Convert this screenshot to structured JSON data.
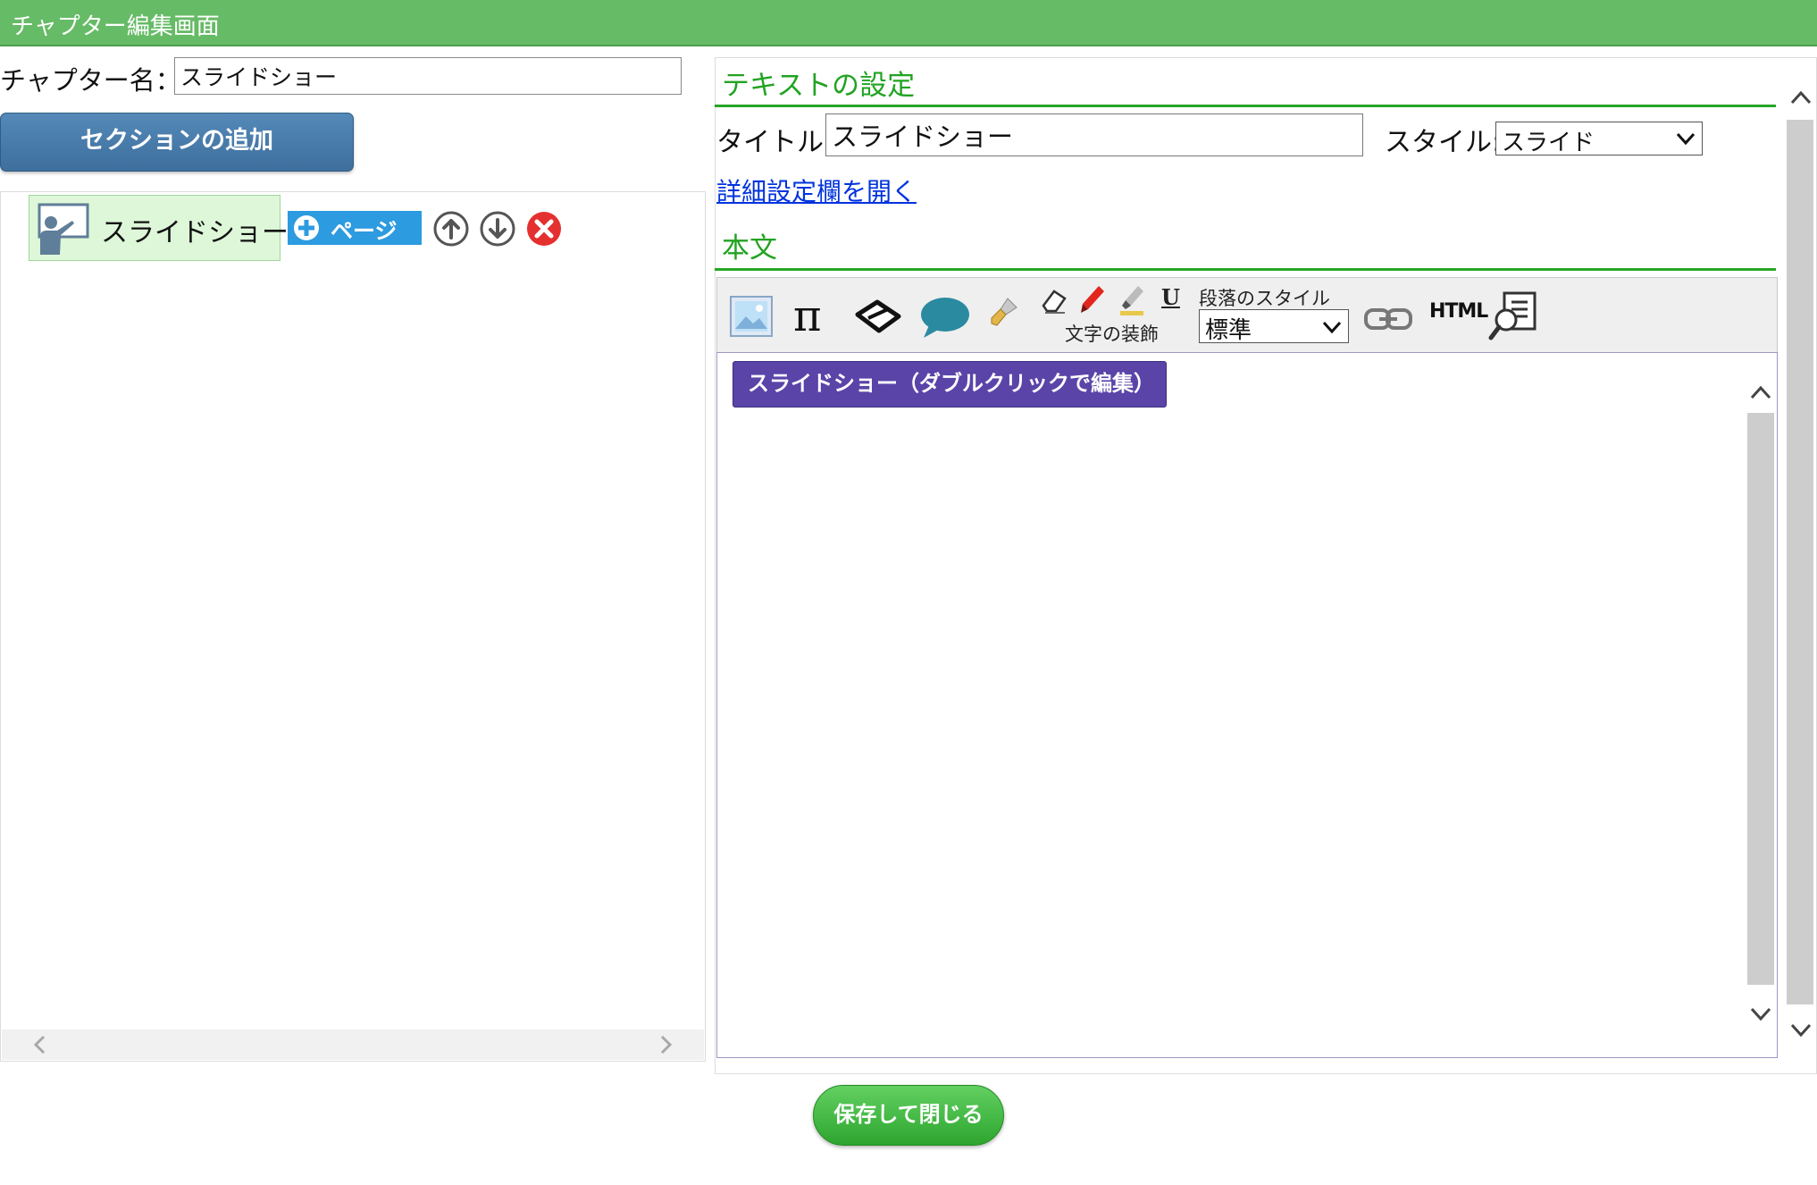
{
  "window": {
    "title": "チャプター編集画面"
  },
  "chapter": {
    "name_label": "チャプター名：",
    "name_value": "スライドショー"
  },
  "left": {
    "add_section_label": "セクションの追加",
    "tree": {
      "item_label": "スライドショー",
      "add_page_label": "ページ"
    }
  },
  "text_settings": {
    "heading": "テキストの設定",
    "title_label": "タイトル:",
    "title_value": "スライドショー",
    "style_label": "スタイル:",
    "style_value": "スライド",
    "open_details_link": "詳細設定欄を開く"
  },
  "body": {
    "heading": "本文",
    "toolbar": {
      "decoration_label": "文字の装飾",
      "paragraph_style_label": "段落のスタイル",
      "paragraph_style_value": "標準",
      "html_label": "HTML"
    },
    "editor": {
      "slide_block_text": "スライドショー（ダブルクリックで編集）"
    }
  },
  "footer": {
    "save_close_label": "保存して閉じる"
  },
  "colors": {
    "header_bg": "#66bb66",
    "accent_green": "#22a322",
    "section_button": "#4a7fae",
    "page_button": "#2d9be0",
    "slide_block": "#5a44a8",
    "save_button": "#3cb83c",
    "link": "#0033dd",
    "delete_red": "#e53030"
  }
}
